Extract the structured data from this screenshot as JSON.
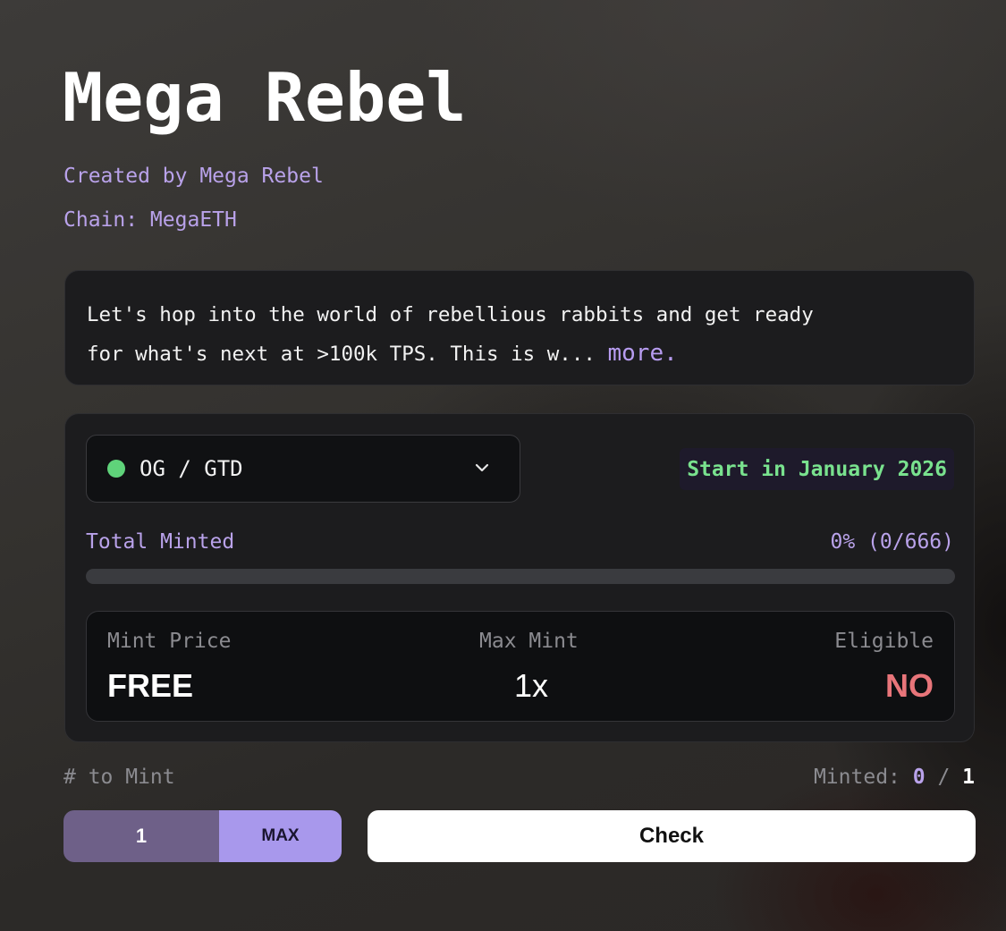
{
  "collection": {
    "title": "Mega Rebel",
    "creator": "Created by Mega Rebel",
    "chain": "Chain: MegaETH"
  },
  "description": {
    "text": "Let's hop into the world of rebellious rabbits and get ready\nfor what's next at >100k TPS. This is w... ",
    "more_label": "more."
  },
  "phase": {
    "selected": "OG / GTD",
    "status_color": "#5fd37a",
    "start_label": "Start in January 2026",
    "total_minted_label": "Total Minted",
    "total_minted_value": "0% (0/666)",
    "progress_fraction": 0,
    "stats": {
      "mint_price_label": "Mint Price",
      "mint_price_value": "FREE",
      "max_mint_label": "Max Mint",
      "max_mint_value": "1x",
      "eligible_label": "Eligible",
      "eligible_value": "NO"
    }
  },
  "mint_controls": {
    "to_mint_label": "# to Mint",
    "minted_prefix": "Minted: ",
    "minted_current": "0",
    "minted_separator": " / ",
    "minted_total": "1",
    "quantity": "1",
    "max_label": "MAX",
    "check_label": "Check"
  },
  "colors": {
    "accent_purple": "#b9a2ea",
    "eligible_no": "#e8757a",
    "start_green": "#79e28e"
  },
  "icons": {
    "dropdown": "chevron-down-icon",
    "status": "status-dot-icon"
  }
}
